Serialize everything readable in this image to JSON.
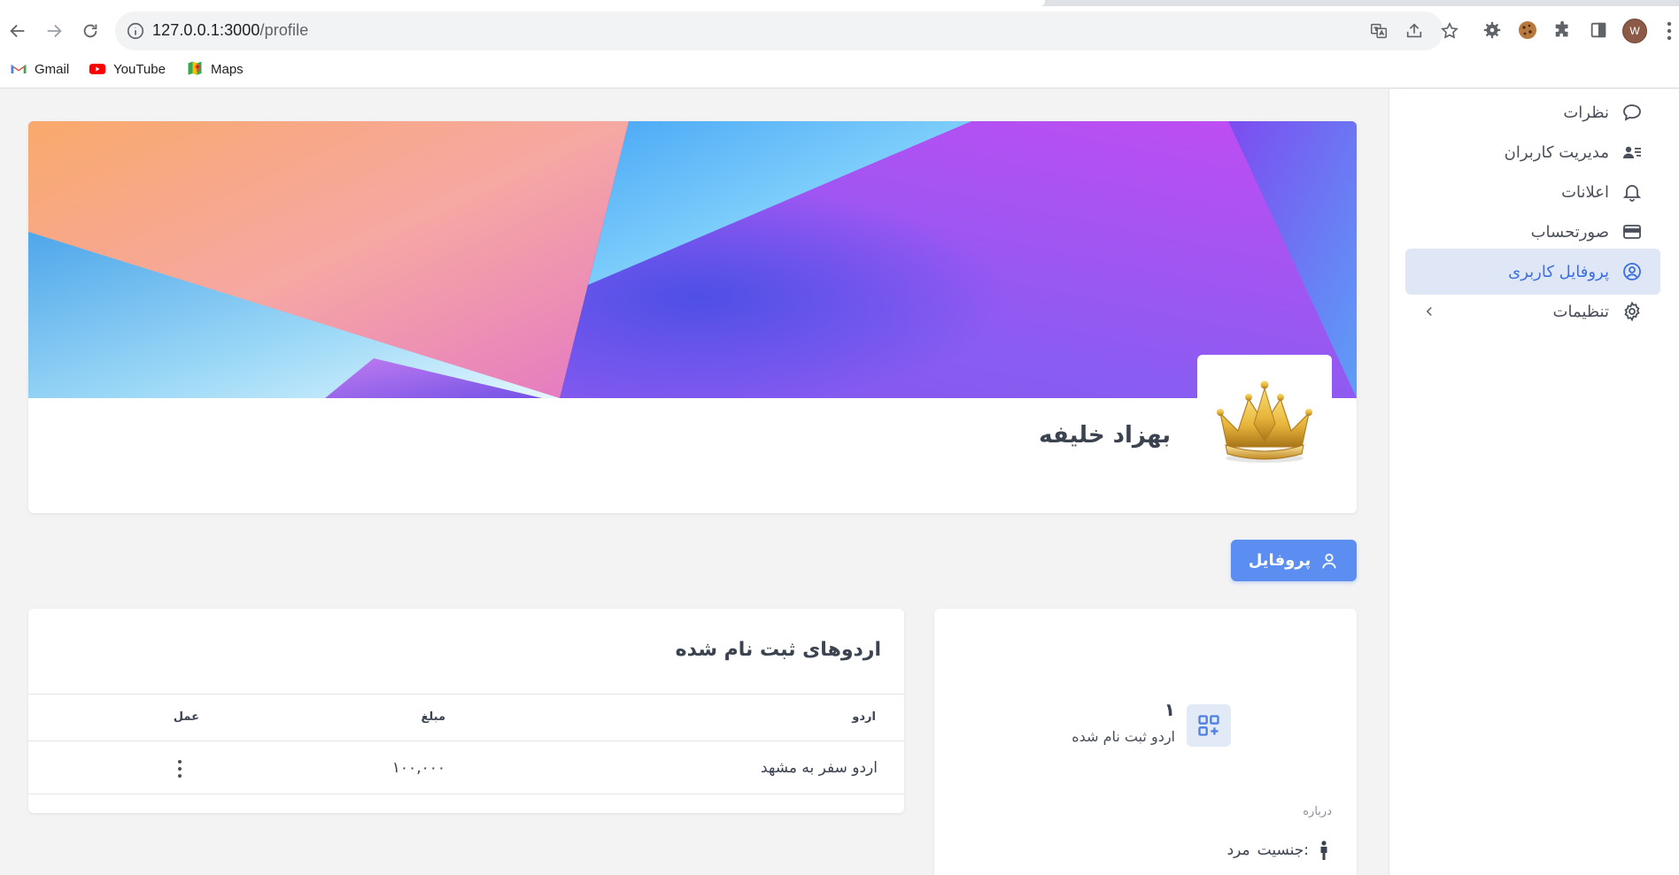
{
  "browser": {
    "url_host": "127.0.0.1:3000",
    "url_path": "/profile",
    "avatar_letter": "W",
    "bookmarks": [
      {
        "label": "Gmail",
        "icon": "gmail-icon"
      },
      {
        "label": "YouTube",
        "icon": "youtube-icon"
      },
      {
        "label": "Maps",
        "icon": "maps-icon"
      }
    ]
  },
  "sidebar": {
    "items": [
      {
        "label": "نظرات",
        "icon": "chat-bubble-icon"
      },
      {
        "label": "مدیریت کاربران",
        "icon": "user-list-icon"
      },
      {
        "label": "اعلانات",
        "icon": "bell-icon"
      },
      {
        "label": "صورتحساب",
        "icon": "credit-card-icon"
      },
      {
        "label": "پروفایل کاربری",
        "icon": "user-circle-icon",
        "active": true
      },
      {
        "label": "تنظیمات",
        "icon": "gear-icon"
      }
    ]
  },
  "profile": {
    "name": "بهزاد خلیفه",
    "avatar_icon": "crown-icon",
    "tab_label": "پروفایل"
  },
  "camps": {
    "title": "اردوهای ثبت نام شده",
    "columns": [
      "اردو",
      "مبلغ",
      "عمل"
    ],
    "rows": [
      {
        "name": "اردو سفر به مشهد",
        "amount": "۱۰۰,۰۰۰"
      }
    ]
  },
  "stats": {
    "value": "۱",
    "label": "اردو ثبت نام شده",
    "about_label": "درباره",
    "gender_label": "جنسیت:",
    "gender_value": "مرد"
  },
  "colors": {
    "accent": "#5b8ef0",
    "active_bg": "#dfe6f6",
    "page_bg": "#f3f3f4"
  }
}
